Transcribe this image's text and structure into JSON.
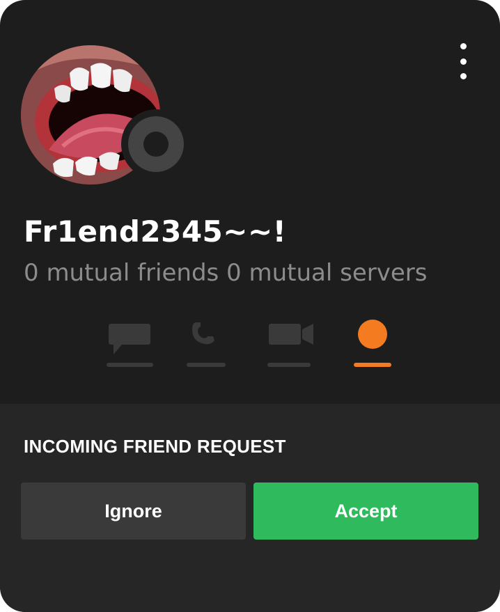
{
  "profile": {
    "username": "Fr1end2345~~!",
    "mutual_text": "0 mutual friends 0 mutual servers",
    "avatar_icon": "open-mouth-avatar",
    "status_icon": "offline-status-icon"
  },
  "actions": [
    {
      "name": "message",
      "icon": "chat-bubble-icon",
      "active": false
    },
    {
      "name": "call",
      "icon": "phone-icon",
      "active": false
    },
    {
      "name": "video",
      "icon": "video-camera-icon",
      "active": false
    },
    {
      "name": "status",
      "icon": "orange-dot-icon",
      "active": true
    }
  ],
  "request": {
    "title": "INCOMING FRIEND REQUEST",
    "ignore_label": "Ignore",
    "accept_label": "Accept"
  },
  "colors": {
    "background": "#1d1d1d",
    "panel": "#262626",
    "accent_orange": "#f47b20",
    "accept_green": "#2fba5d",
    "ignore_gray": "#3a3a3a",
    "muted_text": "#8c8c8c"
  }
}
